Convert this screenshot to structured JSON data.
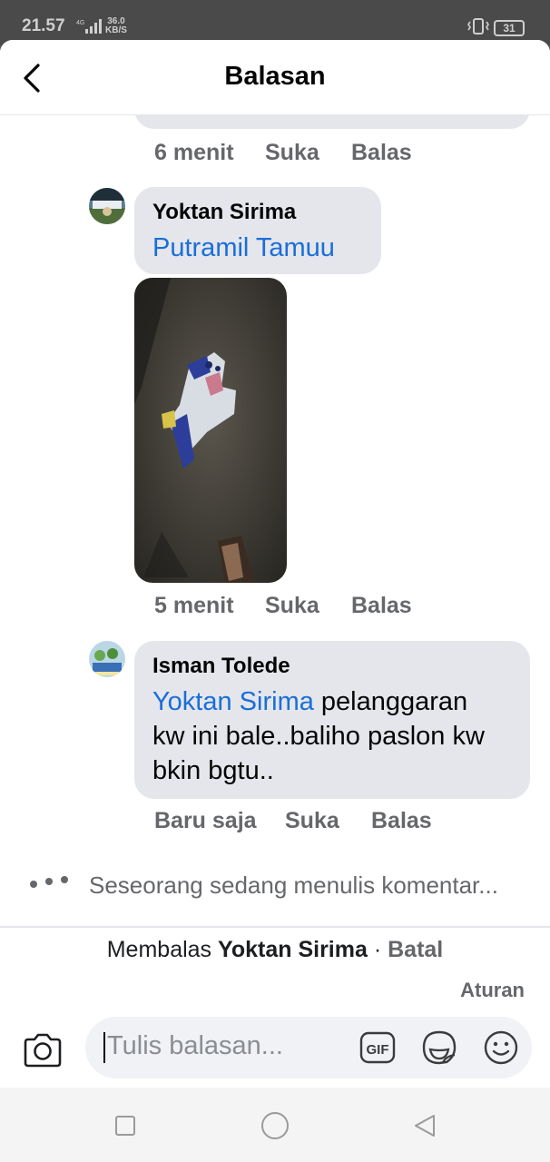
{
  "status_bar": {
    "time": "21.57",
    "network_speed_value": "36.0",
    "network_speed_unit": "KB/S",
    "battery": "31"
  },
  "header": {
    "title": "Balasan"
  },
  "comments": [
    {
      "time": "6 menit",
      "like_label": "Suka",
      "reply_label": "Balas"
    },
    {
      "author": "Yoktan Sirima",
      "mention": "Putramil Tamuu",
      "has_photo": true,
      "time": "5 menit",
      "like_label": "Suka",
      "reply_label": "Balas"
    },
    {
      "author": "Isman Tolede",
      "mention": "Yoktan Sirima",
      "text_line1": "pelanggaran",
      "text_line2": "kw ini bale..baliho paslon kw",
      "text_line3": "bkin bgtu..",
      "time": "Baru saja",
      "like_label": "Suka",
      "reply_label": "Balas"
    }
  ],
  "typing_indicator": "Seseorang sedang menulis komentar...",
  "reply_bar": {
    "prefix": "Membalas",
    "name": "Yoktan Sirima",
    "separator": "·",
    "cancel": "Batal",
    "settings": "Aturan"
  },
  "composer": {
    "placeholder": "Tulis balasan...",
    "icons": [
      "camera-icon",
      "gif-icon",
      "sticker-icon",
      "emoji-icon"
    ]
  },
  "colors": {
    "link": "#1a6ed8",
    "bubble": "#e4e6eb",
    "meta": "#65676b"
  }
}
